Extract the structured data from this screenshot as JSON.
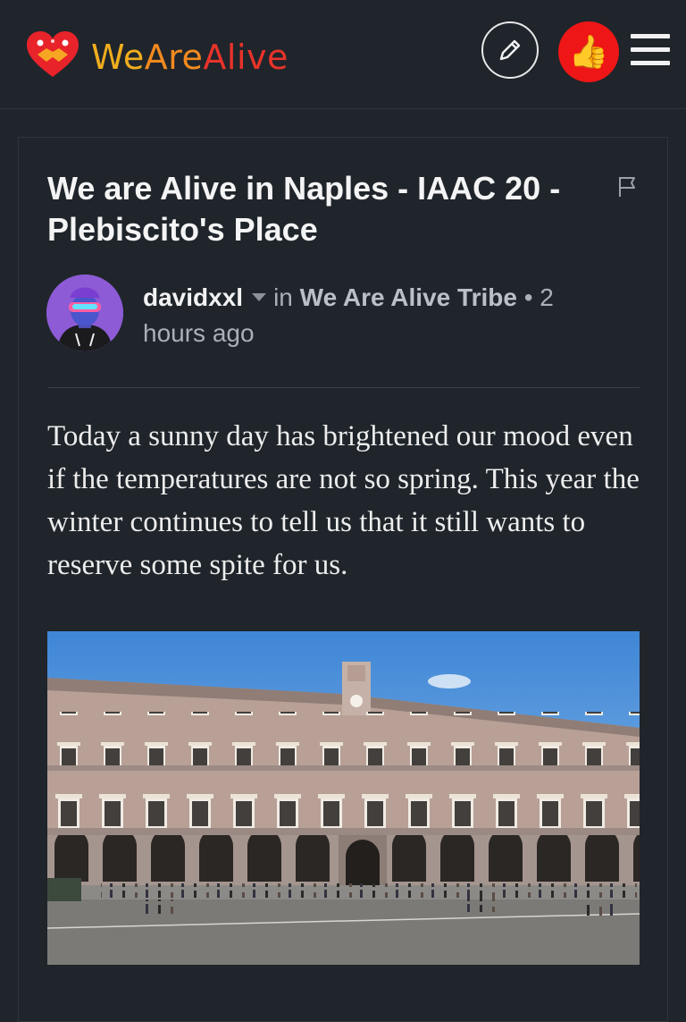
{
  "header": {
    "brand_we": "We",
    "brand_are": "Are",
    "brand_alive": "Alive",
    "like_icon": "👍",
    "colors": {
      "we": "#f0ad1e",
      "are": "#f38a1f",
      "alive": "#e9332a",
      "like_button": "#ee1616"
    }
  },
  "post": {
    "title": "We are Alive in Naples - IAAC 20 - Plebiscito's Place",
    "author": "davidxxl",
    "in_label": "in",
    "community": "We Are Alive Tribe",
    "separator": "•",
    "time": "2 hours ago",
    "body": "Today a sunny day has brightened our mood even if the temperatures are not so spring. This year the winter continues to tell us that it still wants to reserve some spite for us."
  },
  "icons": {
    "logo": "heart-handshake-icon",
    "edit": "pencil-icon",
    "like": "thumbs-up-icon",
    "menu": "hamburger-menu-icon",
    "flag": "flag-icon",
    "author_caret": "chevron-down-icon"
  }
}
